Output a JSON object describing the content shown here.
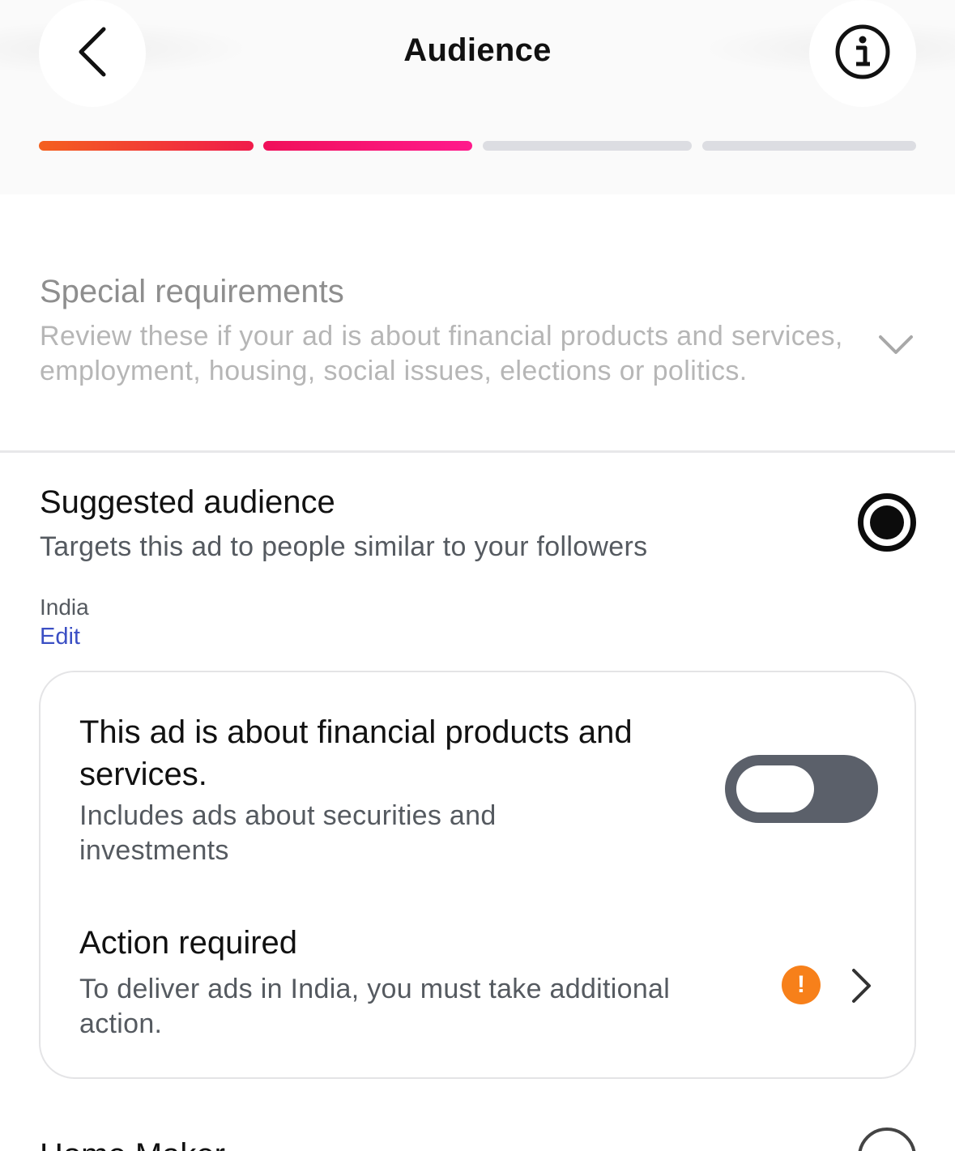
{
  "header": {
    "title": "Audience",
    "back_icon": "chevron-left-icon",
    "info_icon": "info-icon",
    "progress": {
      "total_steps": 4,
      "completed_steps": 2,
      "active_colors": [
        "#f4601e",
        "#f01b4a",
        "#ff1a8c"
      ],
      "inactive_color": "#dcdde2"
    }
  },
  "special_requirements": {
    "title": "Special requirements",
    "description": "Review these if your ad is about financial products and services, employment, housing, social issues, elections or politics.",
    "expand_icon": "chevron-down-icon"
  },
  "suggested_audience": {
    "title": "Suggested audience",
    "description": "Targets this ad to people similar to your followers",
    "selected": true,
    "location": "India",
    "edit_label": "Edit",
    "financial_card": {
      "title": "This ad is about financial products and services.",
      "description": "Includes ads about securities and investments",
      "toggle_on": false,
      "action_title": "Action required",
      "action_description": "To deliver ads in India, you must take additional action.",
      "warning_symbol": "!",
      "warning_color": "#f7801a"
    }
  },
  "next_option": {
    "title": "Home Maker",
    "selected": false
  },
  "colors": {
    "link": "#3b4fc4",
    "toggle_track": "#5b606a"
  }
}
